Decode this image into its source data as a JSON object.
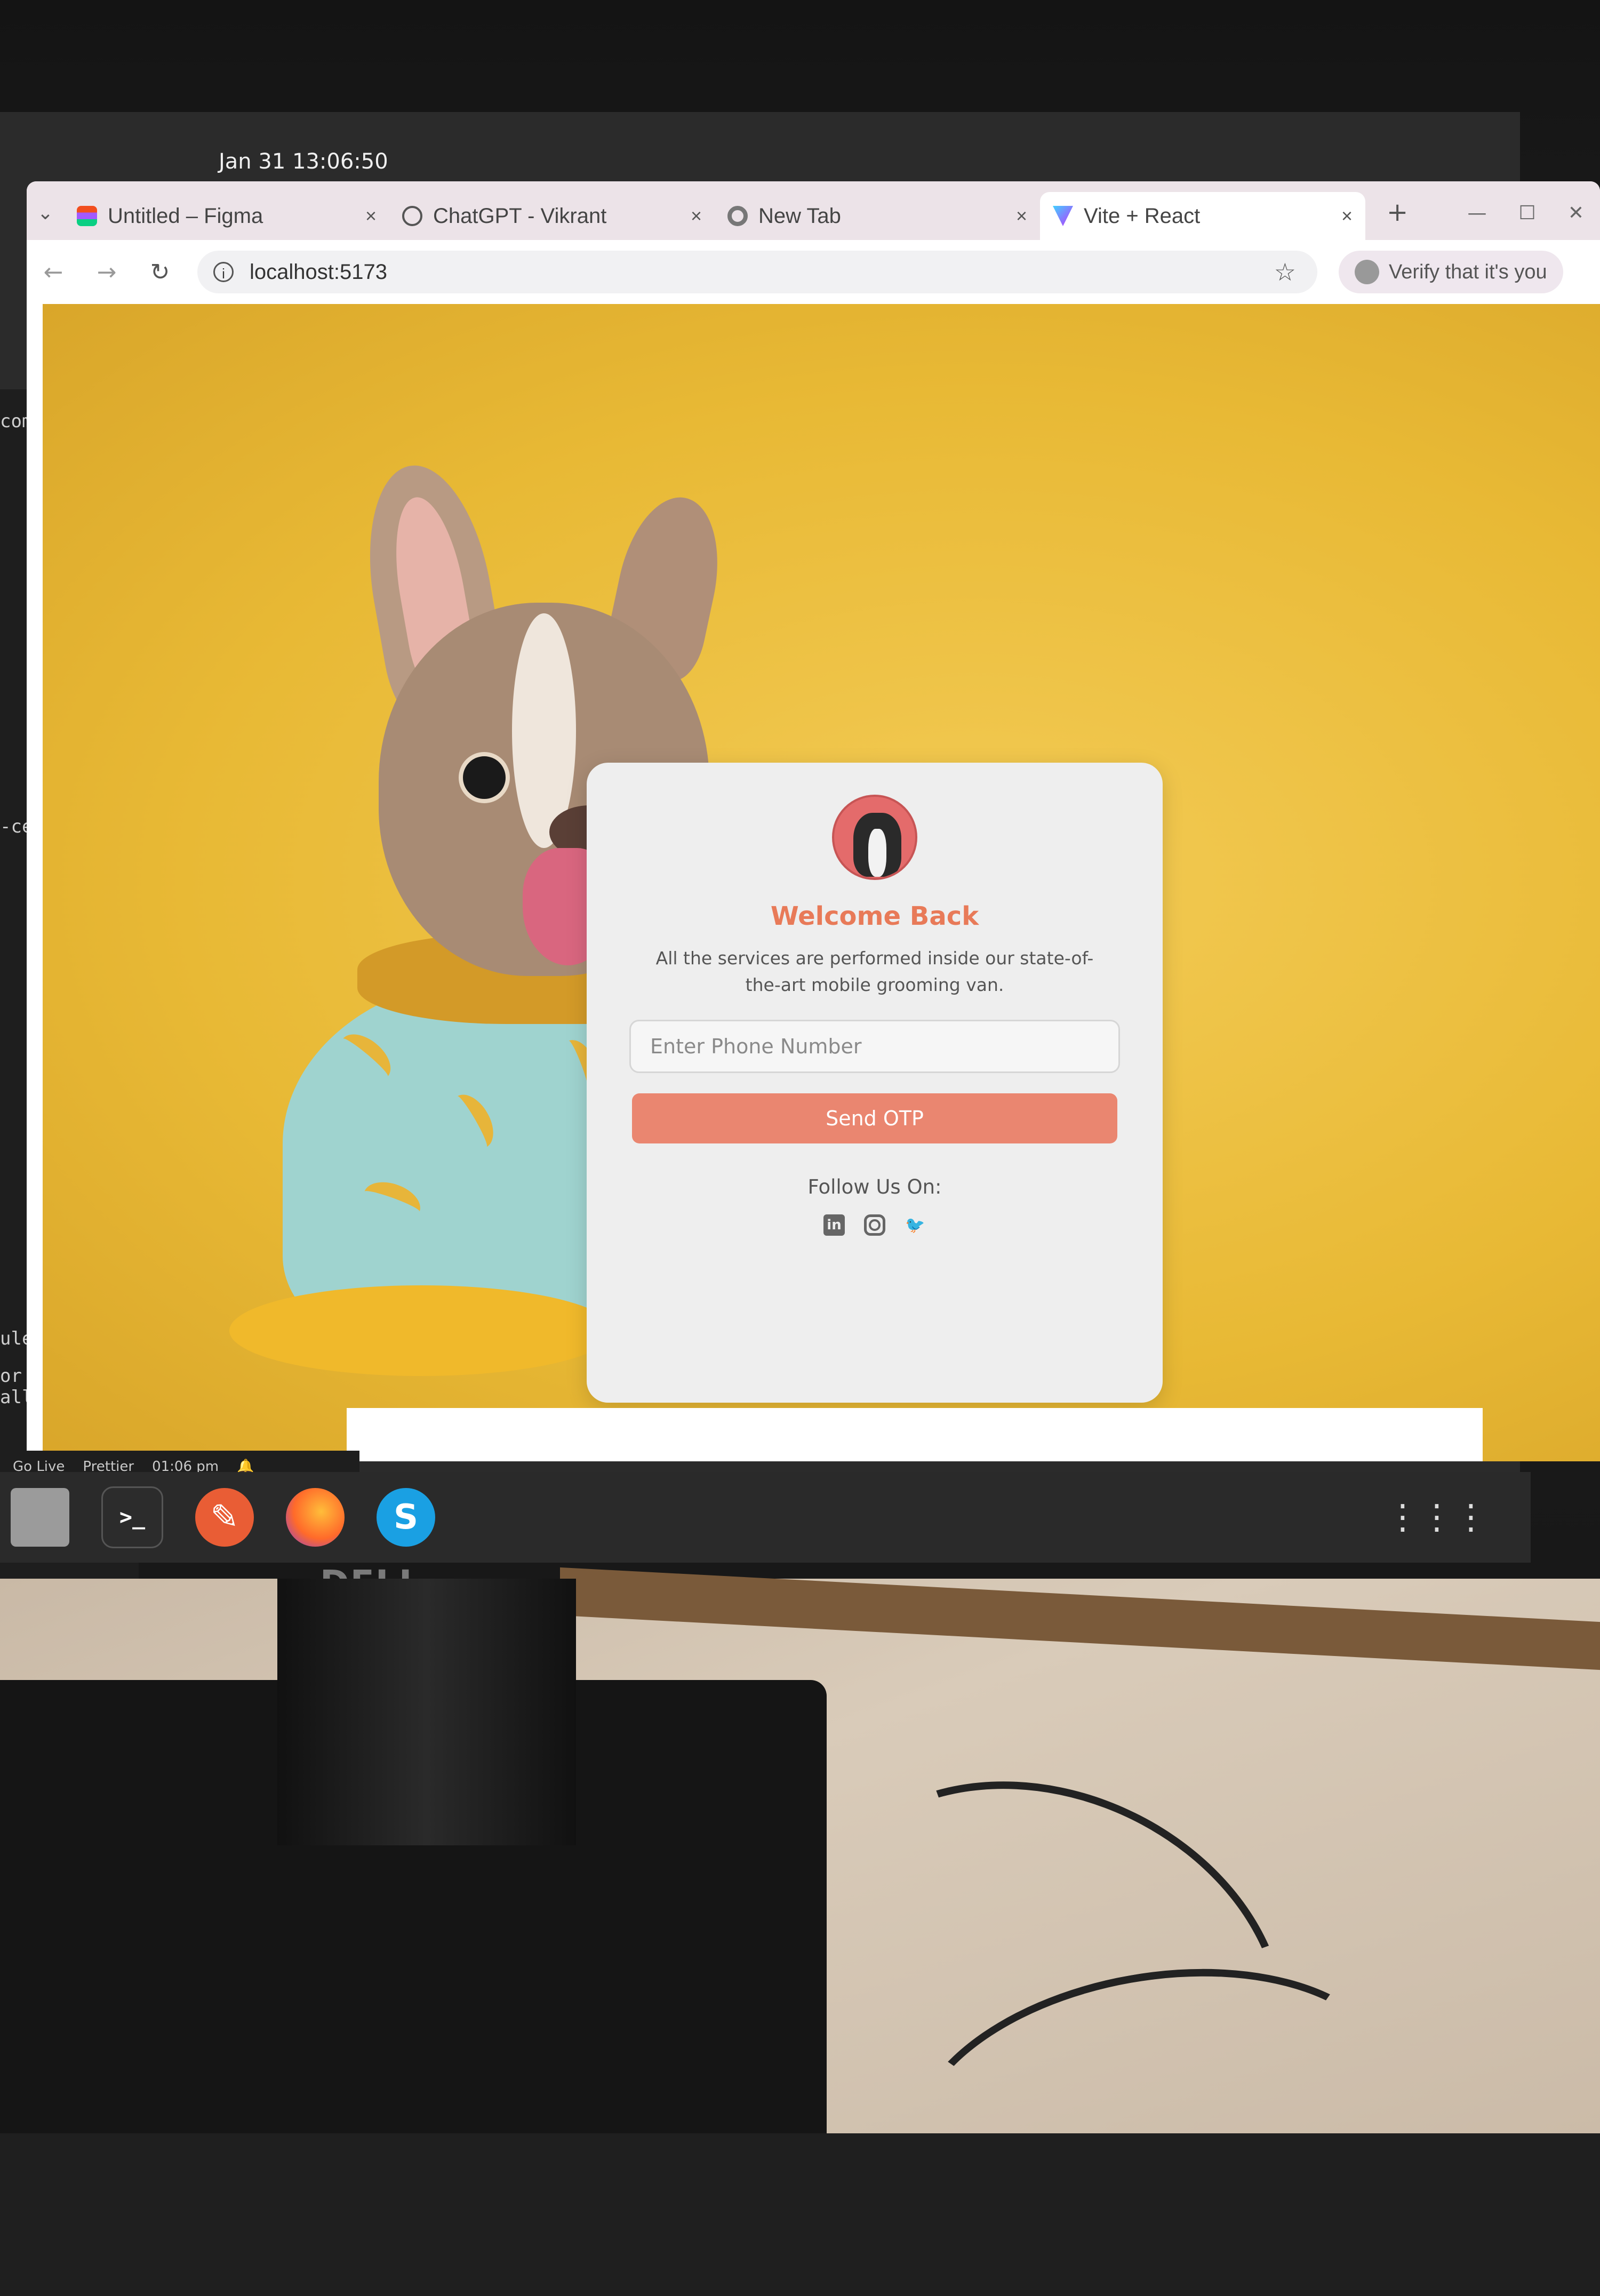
{
  "system": {
    "clock": "Jan 31  13:06:50",
    "monitor_brand": "DELL"
  },
  "browser": {
    "tabs": [
      {
        "title": "Untitled – Figma",
        "active": false,
        "icon": "figma-icon"
      },
      {
        "title": "ChatGPT - Vikrant",
        "active": false,
        "icon": "chatgpt-icon"
      },
      {
        "title": "New Tab",
        "active": false,
        "icon": "chrome-icon"
      },
      {
        "title": "Vite + React",
        "active": true,
        "icon": "vite-icon"
      }
    ],
    "close_glyph": "×",
    "new_tab_glyph": "+",
    "url": "localhost:5173",
    "profile_chip": "Verify that it's you"
  },
  "vscode": {
    "lines": [
      "com",
      "-center",
      "ules/.bin/ta",
      "or directory",
      "all @fortawe"
    ],
    "status": {
      "go_live": "Go Live",
      "prettier": "Prettier",
      "time": "01:06 pm"
    }
  },
  "login": {
    "title": "Welcome Back",
    "description": "All the services are performed inside our state-of-the-art mobile grooming van.",
    "phone_placeholder": "Enter Phone Number",
    "phone_value": "",
    "submit_label": "Send OTP",
    "follow_label": "Follow Us On:",
    "socials": [
      "linkedin-icon",
      "instagram-icon",
      "twitter-icon"
    ]
  },
  "colors": {
    "accent": "#e87a58",
    "button": "#ea8670",
    "background": "#e8b935"
  }
}
